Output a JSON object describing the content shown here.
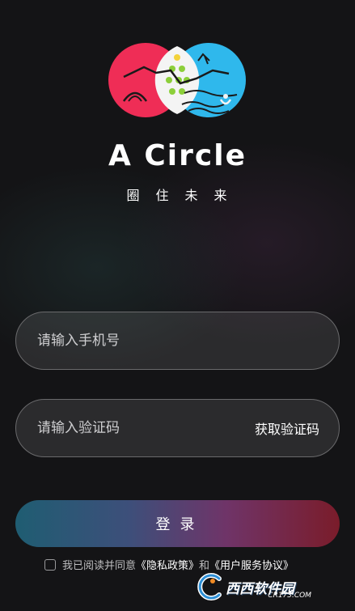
{
  "brand": {
    "title": "A Circle",
    "subtitle": "圈住未来"
  },
  "colors": {
    "background": "#141416",
    "circle_red": "#ef2d56",
    "circle_blue": "#2fb8ec",
    "login_gradient_start": "#1f5d72",
    "login_gradient_end": "#7a1c2a"
  },
  "form": {
    "phone_placeholder": "请输入手机号",
    "code_placeholder": "请输入验证码",
    "get_code_label": "获取验证码",
    "login_label": "登录"
  },
  "agreement": {
    "prefix": "我已阅读并同意",
    "privacy_link": "《隐私政策》",
    "joiner": "和",
    "terms_link": "《用户服务协议》",
    "checked": false
  },
  "watermark": {
    "site_name": "西西软件园",
    "site_url": "CR173.COM"
  }
}
